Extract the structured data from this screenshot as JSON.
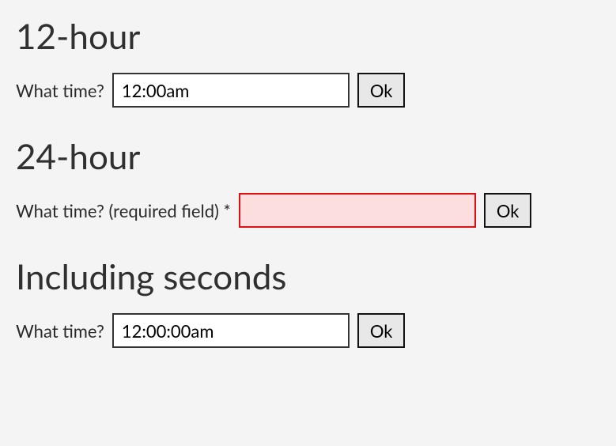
{
  "sections": {
    "twelve": {
      "heading": "12-hour",
      "label": "What time?",
      "value": "12:00am",
      "button": "Ok"
    },
    "twentyfour": {
      "heading": "24-hour",
      "label": "What time? (required field) *",
      "value": "",
      "button": "Ok"
    },
    "seconds": {
      "heading": "Including seconds",
      "label": "What time?",
      "value": "12:00:00am",
      "button": "Ok"
    }
  }
}
